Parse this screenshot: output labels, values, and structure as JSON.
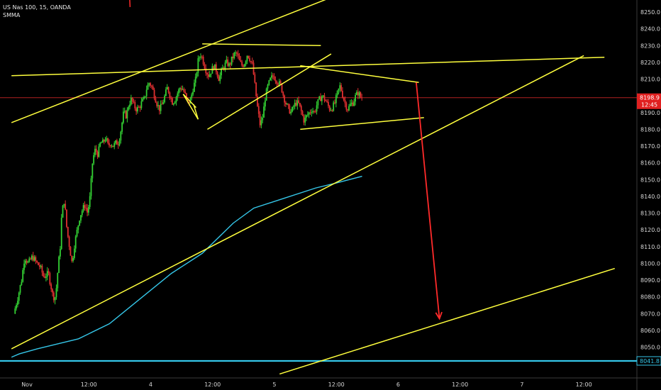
{
  "header": {
    "symbol_line": "US Nas 100, 15, OANDA",
    "indicator": "SMMA"
  },
  "chart_data": {
    "type": "candlestick",
    "ylim": [
      8037,
      8258
    ],
    "y_ticks": [
      8050,
      8060,
      8070,
      8080,
      8090,
      8100,
      8110,
      8120,
      8130,
      8140,
      8150,
      8160,
      8170,
      8180,
      8190,
      8200,
      8210,
      8220,
      8230,
      8240,
      8250
    ],
    "x_ticks": [
      {
        "label": "Nov",
        "t": 0
      },
      {
        "label": "12:00",
        "t": 12
      },
      {
        "label": "4",
        "t": 24
      },
      {
        "label": "12:00",
        "t": 36
      },
      {
        "label": "5",
        "t": 48
      },
      {
        "label": "12:00",
        "t": 60
      },
      {
        "label": "6",
        "t": 72
      },
      {
        "label": "12:00",
        "t": 84
      },
      {
        "label": "7",
        "t": 96
      },
      {
        "label": "12:00",
        "t": 108
      }
    ],
    "x_unit": "hours since Nov 3 00:00",
    "series": [
      {
        "type": "ohlc_close_path",
        "points": [
          [
            -2.3,
            8070
          ],
          [
            -1.5,
            8080
          ],
          [
            -0.8,
            8090
          ],
          [
            -0.2,
            8104
          ],
          [
            0.5,
            8100
          ],
          [
            1.3,
            8104
          ],
          [
            2.2,
            8100
          ],
          [
            2.8,
            8098
          ],
          [
            3.5,
            8092
          ],
          [
            4.4,
            8094
          ],
          [
            5.0,
            8085
          ],
          [
            5.3,
            8080
          ],
          [
            5.8,
            8080
          ],
          [
            6.3,
            8098
          ],
          [
            6.7,
            8110
          ],
          [
            7.0,
            8130
          ],
          [
            7.5,
            8138
          ],
          [
            8.0,
            8120
          ],
          [
            8.5,
            8110
          ],
          [
            9.0,
            8100
          ],
          [
            9.5,
            8112
          ],
          [
            10.0,
            8120
          ],
          [
            10.5,
            8128
          ],
          [
            11.0,
            8132
          ],
          [
            11.5,
            8135
          ],
          [
            12.0,
            8130
          ],
          [
            12.5,
            8140
          ],
          [
            13.0,
            8162
          ],
          [
            13.5,
            8168
          ],
          [
            14.0,
            8165
          ],
          [
            14.5,
            8172
          ],
          [
            15.0,
            8172
          ],
          [
            15.5,
            8175
          ],
          [
            16.0,
            8170
          ],
          [
            16.5,
            8172
          ],
          [
            17.0,
            8170
          ],
          [
            17.5,
            8172
          ],
          [
            18.0,
            8172
          ],
          [
            18.5,
            8180
          ],
          [
            19.0,
            8190
          ],
          [
            19.5,
            8188
          ],
          [
            20.0,
            8195
          ],
          [
            20.5,
            8198
          ],
          [
            21.0,
            8194
          ],
          [
            21.5,
            8192
          ],
          [
            22.0,
            8193
          ],
          [
            22.5,
            8196
          ],
          [
            23.0,
            8198
          ],
          [
            23.5,
            8205
          ],
          [
            24.0,
            8208
          ],
          [
            24.5,
            8205
          ],
          [
            25.0,
            8200
          ],
          [
            25.5,
            8195
          ],
          [
            26.0,
            8192
          ],
          [
            26.5,
            8195
          ],
          [
            27.0,
            8200
          ],
          [
            27.5,
            8205
          ],
          [
            28.0,
            8200
          ],
          [
            28.5,
            8196
          ],
          [
            29.0,
            8198
          ],
          [
            29.5,
            8202
          ],
          [
            30.0,
            8205
          ],
          [
            30.5,
            8204
          ],
          [
            31.0,
            8200
          ],
          [
            31.5,
            8195
          ],
          [
            32.0,
            8198
          ],
          [
            32.5,
            8205
          ],
          [
            33.0,
            8210
          ],
          [
            33.5,
            8222
          ],
          [
            34.0,
            8225
          ],
          [
            34.5,
            8220
          ],
          [
            35.0,
            8215
          ],
          [
            35.5,
            8212
          ],
          [
            36.0,
            8215
          ],
          [
            36.5,
            8218
          ],
          [
            37.0,
            8215
          ],
          [
            37.5,
            8210
          ],
          [
            38.0,
            8215
          ],
          [
            38.5,
            8218
          ],
          [
            39.0,
            8220
          ],
          [
            39.5,
            8218
          ],
          [
            40.0,
            8222
          ],
          [
            40.5,
            8225
          ],
          [
            41.0,
            8225
          ],
          [
            41.5,
            8220
          ],
          [
            42.0,
            8218
          ],
          [
            42.5,
            8220
          ],
          [
            43.0,
            8225
          ],
          [
            43.5,
            8222
          ],
          [
            44.0,
            8218
          ],
          [
            44.5,
            8205
          ],
          [
            45.0,
            8192
          ],
          [
            45.5,
            8182
          ],
          [
            46.0,
            8188
          ],
          [
            46.5,
            8200
          ],
          [
            47.0,
            8206
          ],
          [
            47.5,
            8210
          ],
          [
            48.0,
            8212
          ],
          [
            48.5,
            8210
          ],
          [
            49.0,
            8208
          ],
          [
            49.5,
            8206
          ],
          [
            50.0,
            8200
          ],
          [
            50.5,
            8195
          ],
          [
            51.0,
            8192
          ],
          [
            51.5,
            8190
          ],
          [
            52.0,
            8194
          ],
          [
            52.5,
            8196
          ],
          [
            53.0,
            8195
          ],
          [
            53.5,
            8190
          ],
          [
            54.0,
            8185
          ],
          [
            54.5,
            8188
          ],
          [
            55.0,
            8190
          ],
          [
            55.5,
            8192
          ],
          [
            56.0,
            8190
          ],
          [
            56.5,
            8195
          ],
          [
            57.0,
            8198
          ],
          [
            57.5,
            8200
          ],
          [
            58.0,
            8198
          ],
          [
            58.5,
            8195
          ],
          [
            59.0,
            8192
          ],
          [
            59.5,
            8193
          ],
          [
            60.0,
            8196
          ],
          [
            60.5,
            8202
          ],
          [
            61.0,
            8206
          ],
          [
            61.5,
            8200
          ],
          [
            62.0,
            8195
          ],
          [
            62.5,
            8192
          ],
          [
            63.0,
            8195
          ],
          [
            63.5,
            8196
          ],
          [
            64.0,
            8200
          ],
          [
            64.5,
            8202
          ],
          [
            65.0,
            8198.9
          ]
        ]
      },
      {
        "type": "smma",
        "points": [
          [
            -3,
            8044
          ],
          [
            -1.5,
            8046
          ],
          [
            2,
            8049
          ],
          [
            10,
            8055
          ],
          [
            16,
            8064
          ],
          [
            22,
            8079
          ],
          [
            28,
            8094
          ],
          [
            34,
            8106
          ],
          [
            40,
            8124
          ],
          [
            44,
            8133
          ],
          [
            50,
            8139
          ],
          [
            56,
            8145
          ],
          [
            60,
            8148
          ],
          [
            65,
            8152
          ]
        ]
      }
    ],
    "drawings": [
      {
        "kind": "trendline",
        "color": "#ffff3d",
        "points": [
          [
            -3,
            8184
          ],
          [
            70,
            8272
          ]
        ]
      },
      {
        "kind": "trendline",
        "color": "#ffff3d",
        "points": [
          [
            -3,
            8212
          ],
          [
            112,
            8223
          ]
        ]
      },
      {
        "kind": "trendline",
        "color": "#ffff3d",
        "points": [
          [
            -3,
            8049
          ],
          [
            108,
            8224
          ]
        ]
      },
      {
        "kind": "trendline",
        "color": "#ffff3d",
        "points": [
          [
            49,
            8034
          ],
          [
            114,
            8097
          ]
        ]
      },
      {
        "kind": "trendline",
        "color": "#ffff3d",
        "points": [
          [
            34,
            8231
          ],
          [
            57,
            8230
          ]
        ]
      },
      {
        "kind": "trendline",
        "color": "#ffff3d",
        "points": [
          [
            35,
            8180
          ],
          [
            59,
            8225
          ]
        ]
      },
      {
        "kind": "trendline",
        "color": "#ffff3d",
        "points": [
          [
            53,
            8218
          ],
          [
            76,
            8208
          ]
        ]
      },
      {
        "kind": "trendline",
        "color": "#ffff3d",
        "points": [
          [
            53,
            8180
          ],
          [
            77,
            8187
          ]
        ]
      },
      {
        "kind": "trendline",
        "color": "#ffff3d",
        "points": [
          [
            30.3,
            8201
          ],
          [
            33.2,
            8186
          ]
        ]
      },
      {
        "kind": "trendline",
        "color": "#ffff3d",
        "points": [
          [
            30.3,
            8201
          ],
          [
            32.8,
            8193
          ]
        ]
      },
      {
        "kind": "trendline",
        "color": "#ffff3d",
        "points": [
          [
            32.3,
            8195
          ],
          [
            33.2,
            8186
          ]
        ]
      },
      {
        "kind": "horizontal",
        "color": "#35c6e8",
        "value": 8041.8
      },
      {
        "kind": "horizontal",
        "color": "#b02020",
        "value": 8198.9
      },
      {
        "kind": "arrow",
        "color": "#ff2a2a",
        "points": [
          [
            75.5,
            8208
          ],
          [
            80,
            8067
          ]
        ]
      },
      {
        "kind": "trendline",
        "color": "#ff2a2a",
        "points": [
          [
            19.7,
            8273
          ],
          [
            20.0,
            8253
          ]
        ]
      }
    ],
    "price_label": {
      "value": "8198.9",
      "countdown": "12:45",
      "color": "#e02020"
    },
    "line_label": {
      "value": "8041.8",
      "color": "#35c6e8"
    }
  }
}
